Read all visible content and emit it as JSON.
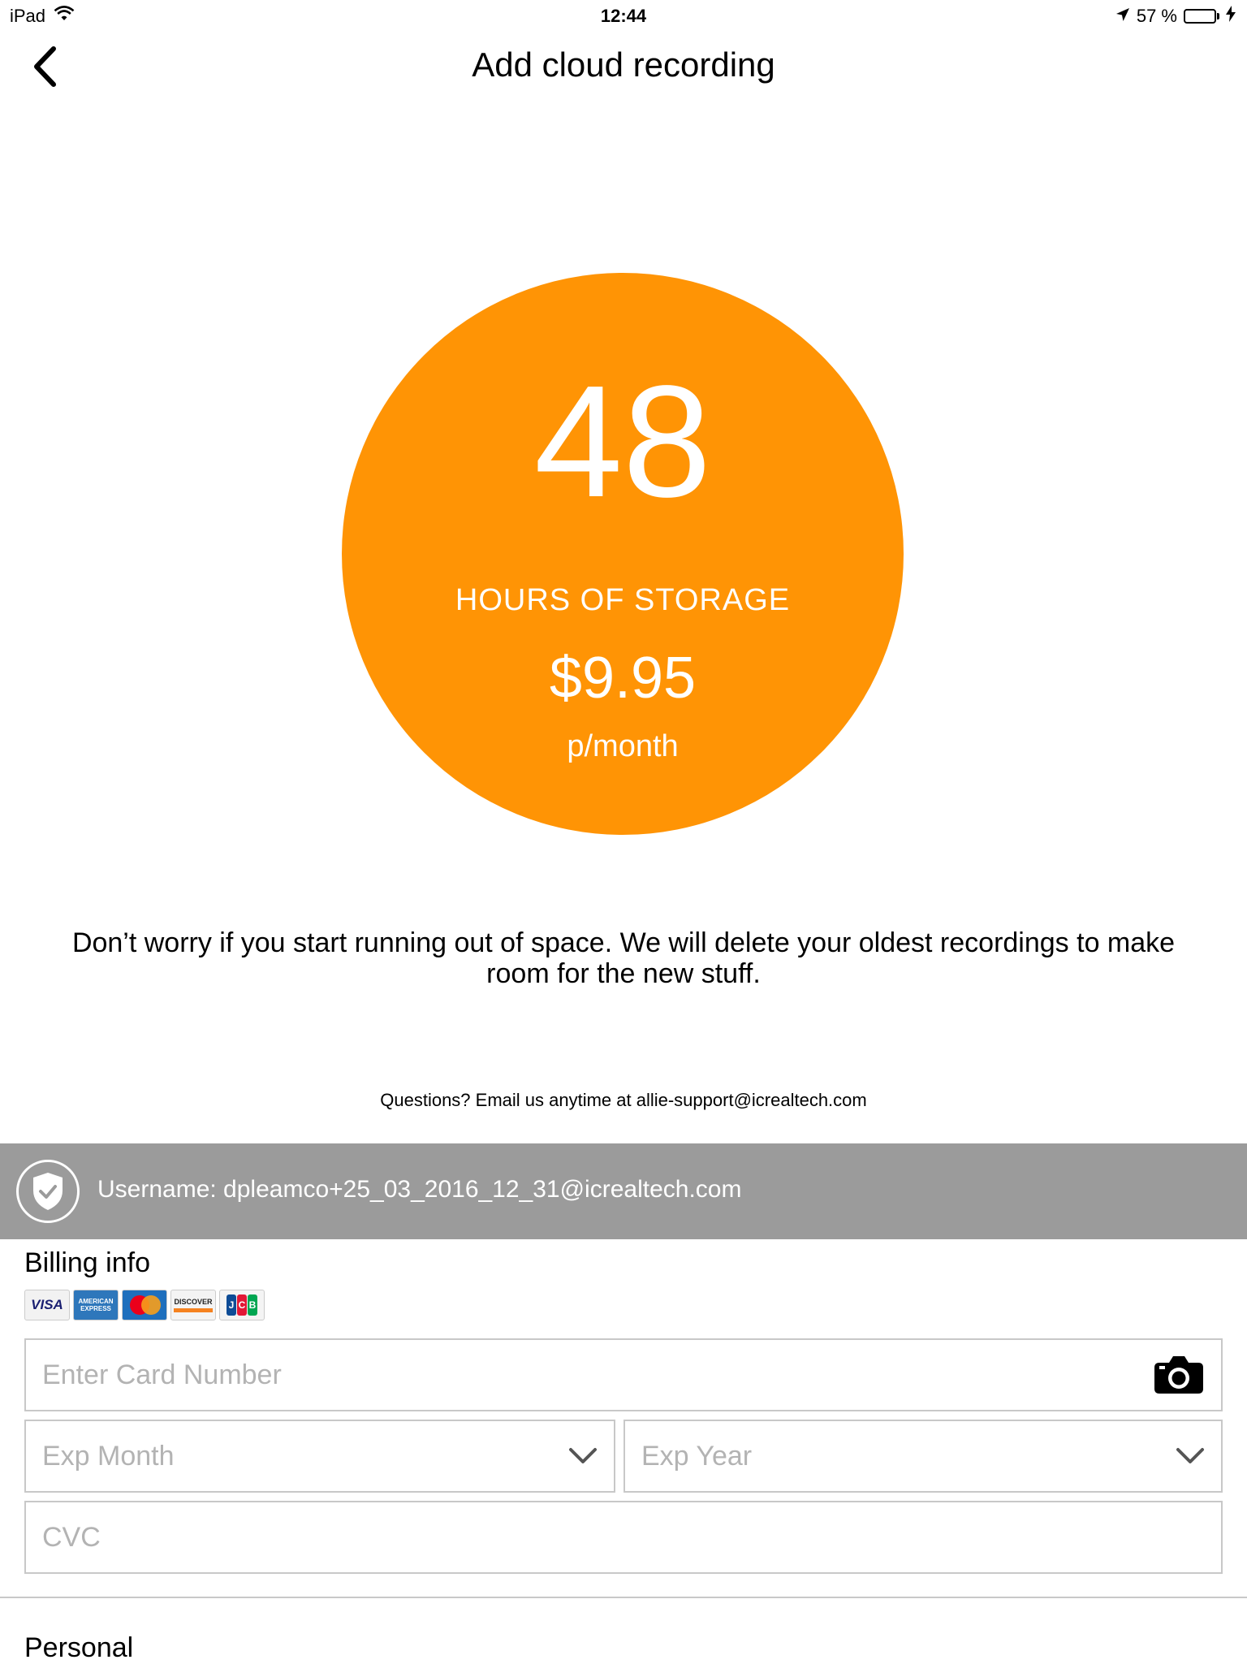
{
  "status_bar": {
    "device": "iPad",
    "time": "12:44",
    "battery": "57 %",
    "battery_level": 0.57,
    "icons": [
      "wifi-icon",
      "location-arrow-icon",
      "battery-icon",
      "charging-bolt-icon"
    ]
  },
  "nav": {
    "title": "Add cloud recording",
    "back_icon": "chevron-left-icon"
  },
  "plan": {
    "hours": "48",
    "unit_label": "HOURS OF STORAGE",
    "price": "$9.95",
    "period": "p/month",
    "color": "#ff9405"
  },
  "info": {
    "text": "Don’t worry if you start running out of space. We will delete your oldest recordings to make room for the new stuff.",
    "questions": "Questions? Email us anytime at allie-support@icrealtech.com"
  },
  "account": {
    "username_text": "Username: dpleamco+25_03_2016_12_31@icrealtech.com",
    "icon": "shield-check-icon",
    "banner_color": "#9b9b9b"
  },
  "billing": {
    "heading": "Billing info",
    "card_logos": {
      "visa": "VISA",
      "amex_line1": "AMERICAN",
      "amex_line2": "EXPRESS",
      "discover": "DISCOVER",
      "jcb": [
        "J",
        "C",
        "B"
      ]
    },
    "card_number_placeholder": "Enter Card Number",
    "exp_month_placeholder": "Exp Month",
    "exp_year_placeholder": "Exp Year",
    "cvc_placeholder": "CVC",
    "camera_icon": "camera-icon",
    "dropdown_icon": "chevron-down-icon"
  },
  "personal": {
    "heading": "Personal"
  }
}
